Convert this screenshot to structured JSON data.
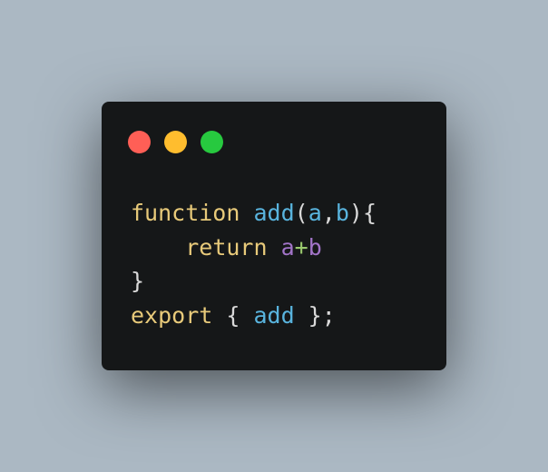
{
  "colors": {
    "background": "#abb8c3",
    "window": "#151718",
    "close": "#ff5f56",
    "minimize": "#ffbd2e",
    "maximize": "#27c93f",
    "keyword": "#e8ca7a",
    "identifier": "#59b4de",
    "param": "#a274c8",
    "operator": "#9ac96e",
    "plain": "#d9d9d9"
  },
  "window_controls": [
    {
      "name": "close-button",
      "color": "#ff5f56"
    },
    {
      "name": "minimize-button",
      "color": "#ffbd2e"
    },
    {
      "name": "maximize-button",
      "color": "#27c93f"
    }
  ],
  "code": {
    "lines": [
      [
        {
          "text": "function",
          "color": "#e8ca7a"
        },
        {
          "text": " ",
          "color": "#d9d9d9"
        },
        {
          "text": "add",
          "color": "#59b4de"
        },
        {
          "text": "(",
          "color": "#d9d9d9"
        },
        {
          "text": "a",
          "color": "#59b4de"
        },
        {
          "text": ",",
          "color": "#d9d9d9"
        },
        {
          "text": "b",
          "color": "#59b4de"
        },
        {
          "text": "){",
          "color": "#d9d9d9"
        }
      ],
      [
        {
          "text": "    ",
          "color": "#d9d9d9"
        },
        {
          "text": "return",
          "color": "#e8ca7a"
        },
        {
          "text": " ",
          "color": "#d9d9d9"
        },
        {
          "text": "a",
          "color": "#a274c8"
        },
        {
          "text": "+",
          "color": "#9ac96e"
        },
        {
          "text": "b",
          "color": "#a274c8"
        }
      ],
      [
        {
          "text": "}",
          "color": "#d9d9d9"
        }
      ],
      [
        {
          "text": "export",
          "color": "#e8ca7a"
        },
        {
          "text": " { ",
          "color": "#d9d9d9"
        },
        {
          "text": "add",
          "color": "#59b4de"
        },
        {
          "text": " };",
          "color": "#d9d9d9"
        }
      ]
    ]
  }
}
